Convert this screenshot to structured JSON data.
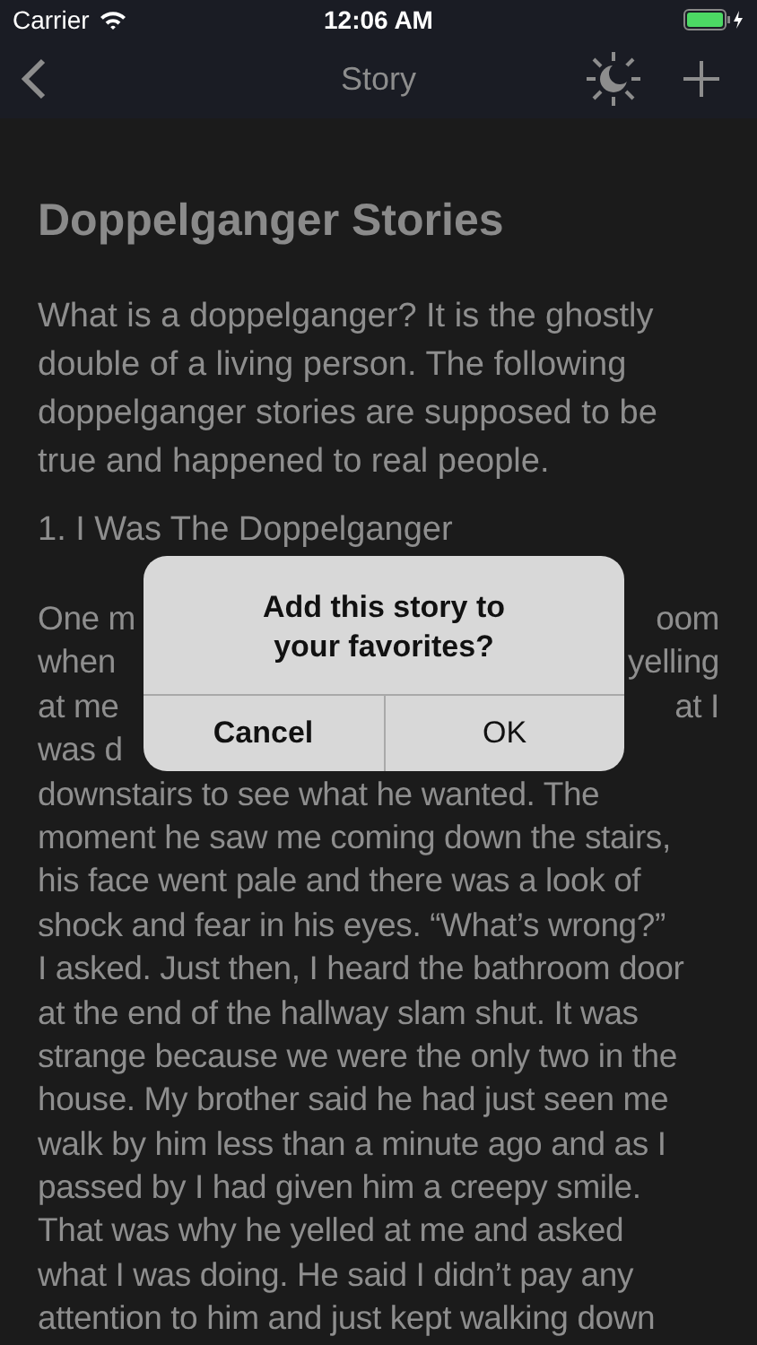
{
  "status_bar": {
    "carrier": "Carrier",
    "time": "12:06 AM"
  },
  "nav_bar": {
    "title": "Story"
  },
  "article": {
    "title": "Doppelganger Stories",
    "intro_lines": [
      "What is a doppelganger? It is the ghostly",
      "double of a living person. The following",
      "doppelganger stories are supposed to be",
      "true and happened to real people."
    ],
    "section_heading": "1. I Was The Doppelganger",
    "story_lines": [
      {
        "left": "One m",
        "right": "oom"
      },
      {
        "left": "when",
        "right": "yelling"
      },
      {
        "left": "at me",
        "right": "at I"
      },
      {
        "left": "was d"
      },
      {
        "left": "downstairs to see what he wanted. The"
      },
      {
        "left": "moment he saw me coming down the stairs,"
      },
      {
        "left": "his face went pale and there was a look of"
      },
      {
        "left": "shock and fear in his eyes. “What’s wrong?”"
      },
      {
        "left": "I asked. Just then, I heard the bathroom door"
      },
      {
        "left": "at the end of the hallway slam shut. It was"
      },
      {
        "left": "strange because we were the only two in the"
      },
      {
        "left": "house. My brother said he had just seen me"
      },
      {
        "left": "walk by him less than a minute ago and as I"
      },
      {
        "left": "passed by I had given him a creepy smile."
      },
      {
        "left": "That was why he yelled at me and asked"
      },
      {
        "left": "what I was doing. He said I didn’t pay any"
      },
      {
        "left": "attention to him and just kept walking down"
      }
    ]
  },
  "alert": {
    "message": "Add this story to your favorites?",
    "buttons": [
      {
        "label": "Cancel",
        "kind": "cancel"
      },
      {
        "label": "OK",
        "kind": "default"
      }
    ]
  }
}
